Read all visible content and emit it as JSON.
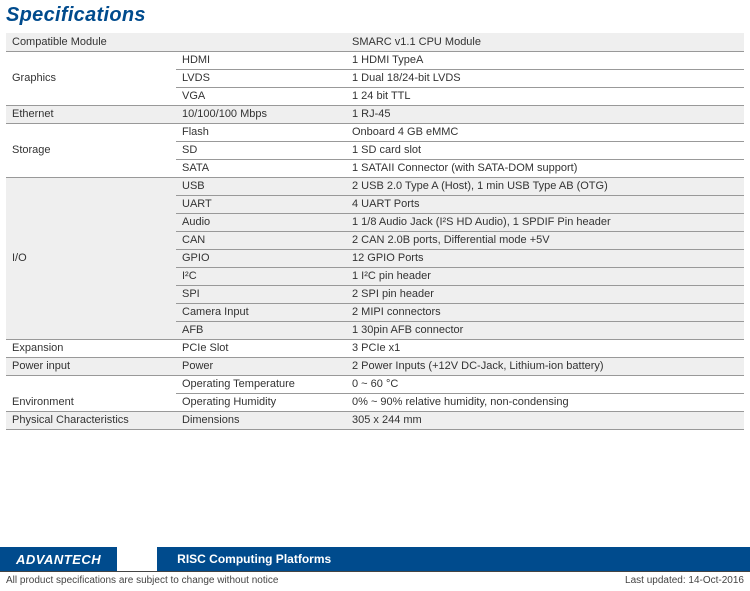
{
  "title": "Specifications",
  "rows": [
    {
      "cat": "Compatible Module",
      "sub": "",
      "val": "SMARC v1.1 CPU Module",
      "alt": true,
      "catshow": true
    },
    {
      "cat": "Graphics",
      "sub": "HDMI",
      "val": "1 HDMI TypeA",
      "alt": false,
      "catshow": false
    },
    {
      "cat": "Graphics",
      "sub": "LVDS",
      "val": "1 Dual 18/24-bit LVDS",
      "alt": false,
      "catshow": true
    },
    {
      "cat": "Graphics",
      "sub": "VGA",
      "val": "1 24 bit TTL",
      "alt": false,
      "catshow": false
    },
    {
      "cat": "Ethernet",
      "sub": "10/100/100 Mbps",
      "val": "1 RJ-45",
      "alt": true,
      "catshow": true
    },
    {
      "cat": "Storage",
      "sub": "Flash",
      "val": "Onboard 4 GB eMMC",
      "alt": false,
      "catshow": false
    },
    {
      "cat": "Storage",
      "sub": "SD",
      "val": "1 SD card slot",
      "alt": false,
      "catshow": true
    },
    {
      "cat": "Storage",
      "sub": "SATA",
      "val": "1 SATAII Connector (with SATA-DOM support)",
      "alt": false,
      "catshow": false
    },
    {
      "cat": "I/O",
      "sub": "USB",
      "val": "2 USB 2.0 Type A (Host), 1 min USB Type AB (OTG)",
      "alt": true,
      "catshow": false
    },
    {
      "cat": "I/O",
      "sub": "UART",
      "val": "4 UART Ports",
      "alt": true,
      "catshow": false
    },
    {
      "cat": "I/O",
      "sub": "Audio",
      "val": "1 1/8 Audio Jack (I²S HD Audio), 1 SPDIF Pin header",
      "alt": true,
      "catshow": false
    },
    {
      "cat": "I/O",
      "sub": "CAN",
      "val": "2 CAN 2.0B ports, Differential mode +5V",
      "alt": true,
      "catshow": false
    },
    {
      "cat": "I/O",
      "sub": "GPIO",
      "val": "12 GPIO Ports",
      "alt": true,
      "catshow": true
    },
    {
      "cat": "I/O",
      "sub": "I²C",
      "val": "1 I²C pin header",
      "alt": true,
      "catshow": false
    },
    {
      "cat": "I/O",
      "sub": "SPI",
      "val": "2 SPI pin header",
      "alt": true,
      "catshow": false
    },
    {
      "cat": "I/O",
      "sub": "Camera Input",
      "val": "2 MIPI connectors",
      "alt": true,
      "catshow": false
    },
    {
      "cat": "I/O",
      "sub": "AFB",
      "val": "1 30pin AFB connector",
      "alt": true,
      "catshow": false
    },
    {
      "cat": "Expansion",
      "sub": "PCIe Slot",
      "val": "3 PCIe x1",
      "alt": false,
      "catshow": true
    },
    {
      "cat": "Power input",
      "sub": "Power",
      "val": "2 Power Inputs (+12V DC-Jack, Lithium-ion battery)",
      "alt": true,
      "catshow": true
    },
    {
      "cat": "Environment",
      "sub": "Operating Temperature",
      "val": "0 ~ 60 °C",
      "alt": false,
      "catshow": false
    },
    {
      "cat": "Environment",
      "sub": "Operating Humidity",
      "val": "0% ~ 90% relative humidity, non-condensing",
      "alt": false,
      "catshow": true
    },
    {
      "cat": "Physical Characteristics",
      "sub": "Dimensions",
      "val": "305 x 244 mm",
      "alt": true,
      "catshow": true
    }
  ],
  "footer": {
    "brand": "ADVANTECH",
    "platform": "RISC Computing Platforms",
    "disclaimer": "All product specifications are subject to change without notice",
    "updated": "Last updated: 14-Oct-2016"
  }
}
